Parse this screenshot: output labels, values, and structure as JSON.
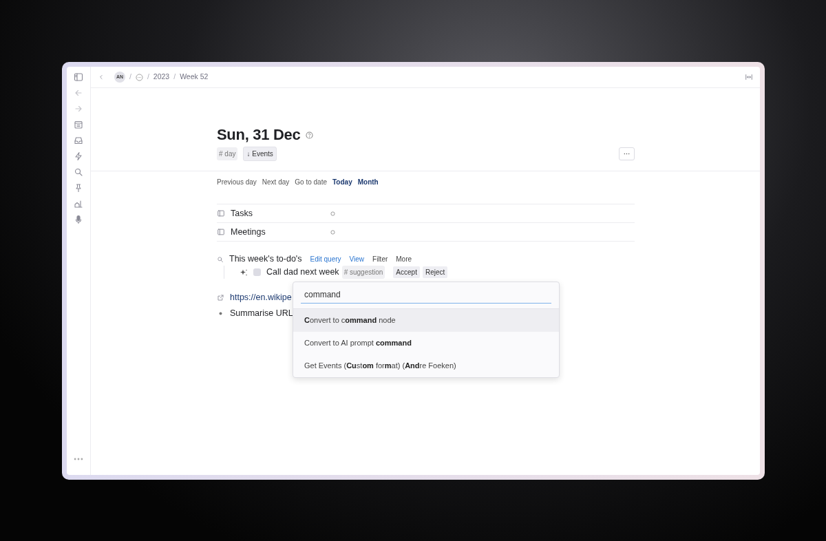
{
  "breadcrumb": {
    "avatar": "AN",
    "separators": [
      "/",
      "/",
      "/"
    ],
    "items": [
      "2023",
      "Week 52"
    ]
  },
  "page": {
    "title": "Sun, 31 Dec",
    "tags": [
      {
        "label": "# day",
        "kind": "tag"
      },
      {
        "label": "↓ Events",
        "kind": "button"
      }
    ]
  },
  "nav_links": [
    {
      "label": "Previous day",
      "emphasis": false
    },
    {
      "label": "Next day",
      "emphasis": false
    },
    {
      "label": "Go to date",
      "emphasis": false
    },
    {
      "label": "Today",
      "emphasis": true
    },
    {
      "label": "Month",
      "emphasis": true
    }
  ],
  "fields": [
    {
      "label": "Tasks"
    },
    {
      "label": "Meetings"
    }
  ],
  "query": {
    "title": "This week's to-do's",
    "actions": [
      {
        "label": "Edit query",
        "kind": "link"
      },
      {
        "label": "View",
        "kind": "link"
      },
      {
        "label": "Filter",
        "kind": "plain"
      },
      {
        "label": "More",
        "kind": "plain"
      }
    ],
    "items": [
      {
        "text": "Call dad next week",
        "checked": false,
        "tag": "# suggestion",
        "buttons": [
          "Accept",
          "Reject"
        ]
      }
    ]
  },
  "nodes": [
    {
      "kind": "url",
      "text": "https://en.wikipe"
    },
    {
      "kind": "bullet",
      "text": "Summarise URL"
    }
  ],
  "command_menu": {
    "value": "command",
    "options": [
      {
        "text": "**C**onvert to c**ommand** node",
        "selected": true
      },
      {
        "text": "Convert to AI prompt **command**",
        "selected": false
      },
      {
        "text": "Get Events (**Cu**st**om** for**m**at) (**And**re Foeken)",
        "selected": false
      }
    ]
  }
}
